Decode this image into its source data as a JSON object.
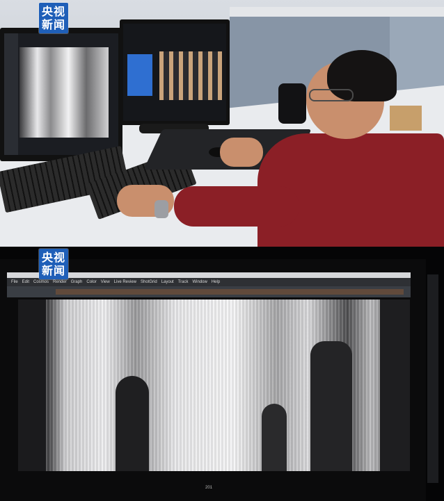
{
  "watermark": {
    "line1": "央视",
    "line2": "新闻"
  },
  "editor": {
    "menu": [
      "File",
      "Edit",
      "Cosmos",
      "Render",
      "Graph",
      "Color",
      "View",
      "Live Review",
      "ShotGrid",
      "Layout",
      "Track",
      "Window",
      "Help"
    ],
    "frame_label": "201"
  },
  "colors": {
    "watermark_bg": "#1f5fb8",
    "shirt": "#8b1f26"
  }
}
